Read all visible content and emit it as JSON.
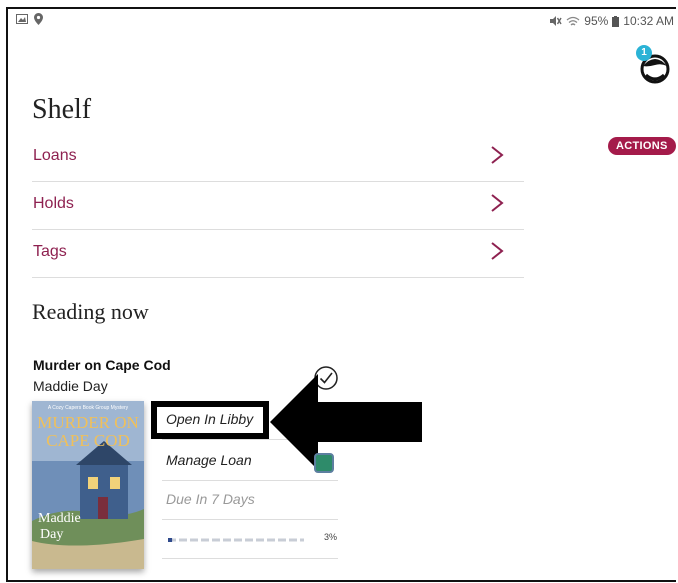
{
  "status_bar": {
    "battery": "95%",
    "time": "10:32 AM",
    "icons": [
      "image-icon",
      "location-icon",
      "mute-icon",
      "wifi-icon",
      "battery-icon"
    ]
  },
  "header": {
    "title": "Shelf",
    "actions_label": "ACTIONS",
    "notification_count": "1"
  },
  "nav": [
    {
      "label": "Loans"
    },
    {
      "label": "Holds"
    },
    {
      "label": "Tags"
    }
  ],
  "reading_now": {
    "heading": "Reading now",
    "book": {
      "title": "Murder on Cape Cod",
      "author": "Maddie Day",
      "cover_series": "A Cozy Capers Book Group Mystery",
      "cover_title_1": "MURDER ON",
      "cover_title_2": "CAPE COD",
      "cover_author_1": "Maddie",
      "cover_author_2": "Day",
      "progress_percent": 3,
      "progress_label": "3%"
    },
    "menu": {
      "open_label": "Open In Libby",
      "manage_label": "Manage Loan",
      "due_label": "Due In 7 Days"
    }
  },
  "colors": {
    "accent": "#8e2150",
    "actions_bg": "#a41b4a",
    "tag_swatch": "#2e8b6a"
  }
}
